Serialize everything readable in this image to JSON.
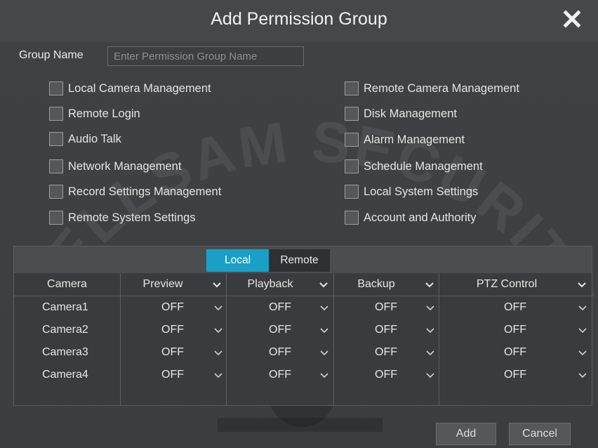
{
  "dialog": {
    "title": "Add Permission Group",
    "group_name_label": "Group Name",
    "group_name_placeholder": "Enter Permission Group Name",
    "group_name_value": ""
  },
  "permissions": {
    "left": [
      "Local Camera Management",
      "Remote Login",
      "Audio Talk",
      "Network Management",
      "Record Settings Management",
      "Remote System Settings"
    ],
    "right": [
      "Remote Camera Management",
      "Disk Management",
      "Alarm Management",
      "Schedule Management",
      "Local System Settings",
      "Account and Authority"
    ]
  },
  "tabs": {
    "local": "Local",
    "remote": "Remote",
    "active": "Local"
  },
  "table": {
    "headers": [
      "Camera",
      "Preview",
      "Playback",
      "Backup",
      "PTZ Control"
    ],
    "rows": [
      [
        "Camera1",
        "OFF",
        "OFF",
        "OFF",
        "OFF"
      ],
      [
        "Camera2",
        "OFF",
        "OFF",
        "OFF",
        "OFF"
      ],
      [
        "Camera3",
        "OFF",
        "OFF",
        "OFF",
        "OFF"
      ],
      [
        "Camera4",
        "OFF",
        "OFF",
        "OFF",
        "OFF"
      ]
    ]
  },
  "buttons": {
    "add": "Add",
    "cancel": "Cancel"
  },
  "watermark": {
    "text": "CELLSAM SECURITY"
  },
  "colors": {
    "accent": "#1aa0c6",
    "background": "#3b3e40",
    "titlebar": "#45484b"
  },
  "icons": {
    "close": "close-icon",
    "dropdown": "chevron-down-icon",
    "checkbox": "checkbox-unchecked"
  }
}
